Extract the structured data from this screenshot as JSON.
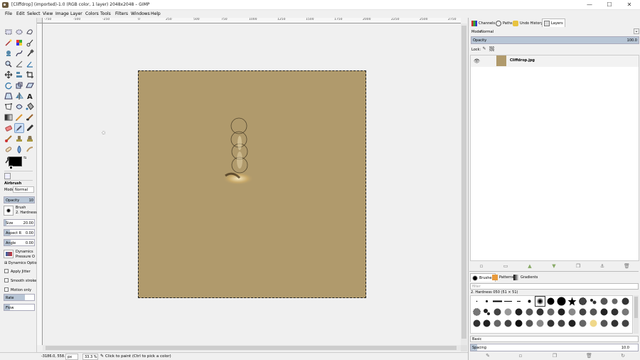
{
  "window": {
    "title": "[Cliffdrop] (imported)-1.0 (RGB color, 1 layer) 2048x2048 – GIMP",
    "minimize": "—",
    "maximize": "☐",
    "close": "✕"
  },
  "menubar": [
    "File",
    "Edit",
    "Select",
    "View",
    "Image",
    "Layer",
    "Colors",
    "Tools",
    "Filters",
    "Windows",
    "Help"
  ],
  "ruler": {
    "ticks": [
      "-750",
      "-500",
      "-250",
      "0",
      "250",
      "500",
      "750",
      "1000",
      "1250",
      "1500",
      "1750",
      "2000",
      "2250",
      "2500",
      "2750"
    ]
  },
  "tool_options": {
    "title": "Airbrush",
    "mode_label": "Mode",
    "mode_value": "Normal",
    "opacity_label": "Opacity",
    "opacity_value": "10",
    "brush_label": "Brush",
    "brush_value": "2. Hardness",
    "size_label": "Size",
    "size_value": "20.00",
    "aspect_label": "Aspect R",
    "aspect_value": "0.00",
    "angle_label": "Angle",
    "angle_value": "0.00",
    "dynamics_label": "Dynamics",
    "dynamics_value": "Pressure O",
    "dynamics_options": "Dynamics Optio",
    "apply_jitter": "Apply Jitter",
    "smooth_stroke": "Smooth stroke",
    "motion_only": "Motion only",
    "rate_label": "Rate",
    "flow_label": "Flow"
  },
  "statusbar": {
    "coords": "-3186.0, 558.0",
    "unit": "px",
    "zoom": "33.3 %",
    "message": "Click to paint (Ctrl to pick a color)"
  },
  "dock": {
    "tabs": [
      "Channels",
      "Paths",
      "Undo History",
      "Layers"
    ],
    "mode_label": "Mode",
    "mode_value": "Normal",
    "opacity_label": "Opacity",
    "opacity_value": "100.0",
    "lock_label": "Lock:",
    "layer_name": "Cliffdrop.jpg",
    "brush_tabs": [
      "Brushes",
      "Patterns",
      "Gradients"
    ],
    "filter_placeholder": "filter",
    "brush_name": "2. Hardness 050 (51 × 51)",
    "brush_tag": "Basic",
    "spacing_label": "Spacing",
    "spacing_value": "10.0"
  },
  "colors": {
    "canvas": "#b09a6c",
    "selection": "#7a9cc6"
  }
}
